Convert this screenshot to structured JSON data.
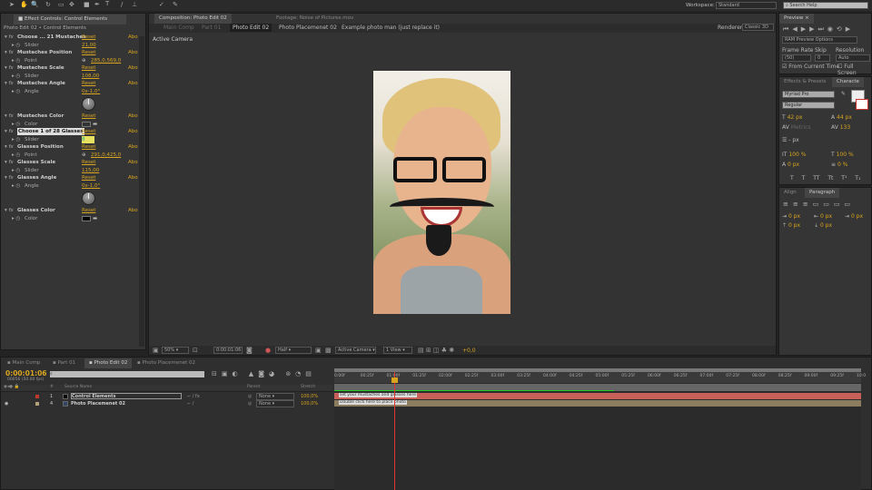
{
  "toolbar": {
    "workspace_label": "Workspace:",
    "workspace_value": "Standard",
    "search_placeholder": "Search Help"
  },
  "effect_controls": {
    "tab": "Effect Controls: Control Elements",
    "breadcrumb": "Photo Edit 02 • Control Elements",
    "reset": "Reset",
    "about": "Abo",
    "effects": [
      {
        "name": "Choose ... 21 Mustaches",
        "prop": "Slider",
        "value": "21,00",
        "kind": "slider"
      },
      {
        "name": "Mustaches Position",
        "prop": "Point",
        "value": "285,0,569,0",
        "kind": "point"
      },
      {
        "name": "Mustaches Scale",
        "prop": "Slider",
        "value": "108,00",
        "kind": "slider"
      },
      {
        "name": "Mustaches Angle",
        "prop": "Angle",
        "value": "0x-1,0°",
        "kind": "angle"
      },
      {
        "name": "Mustaches Color",
        "prop": "Color",
        "value": "",
        "kind": "color",
        "color": "#333333"
      },
      {
        "name": "Choose 1 of 28 Glasses",
        "prop": "Slider",
        "value": "8",
        "kind": "slider",
        "editing": true
      },
      {
        "name": "Glasses Position",
        "prop": "Point",
        "value": "291,0,425,0",
        "kind": "point"
      },
      {
        "name": "Glasses Scale",
        "prop": "Slider",
        "value": "115,00",
        "kind": "slider"
      },
      {
        "name": "Glasses Angle",
        "prop": "Angle",
        "value": "0x-1,0°",
        "kind": "angle"
      },
      {
        "name": "Glasses Color",
        "prop": "Color",
        "value": "",
        "kind": "color",
        "color": "#000000"
      }
    ]
  },
  "composition": {
    "tab": "Composition: Photo Edit 02",
    "footage_tab": "Footage: Noise of Pictures.mov",
    "breadcrumbs": [
      "Main Comp",
      "Part 01",
      "Photo Edit 02",
      "Photo Placemenet 02",
      "Example photo man (just replace it)"
    ],
    "active_camera": "Active Camera",
    "renderer_label": "Renderer:",
    "renderer_value": "Classic 3D",
    "viewer": {
      "zoom": "50%",
      "timecode": "0:00:01:06",
      "resolution": "Half",
      "camera": "Active Camera",
      "views": "1 View",
      "exposure": "+0,0"
    }
  },
  "preview": {
    "tab": "Preview",
    "ram_options": "RAM Preview Options",
    "frame_rate_label": "Frame Rate",
    "frame_rate": "(50)",
    "skip_label": "Skip",
    "skip": "0",
    "resolution_label": "Resolution",
    "resolution": "Auto",
    "from_current": "From Current Time",
    "full_screen": "Full Screen"
  },
  "character": {
    "tabs": [
      "Effects & Presets",
      "Characte"
    ],
    "font": "Myriad Pro",
    "style": "Regular",
    "size": "42 px",
    "leading": "44 px",
    "kerning": "Metrics",
    "tracking": "133",
    "stroke": "- px",
    "vscale": "100 %",
    "hscale": "100 %",
    "baseline": "0 px",
    "tsume": "0 %",
    "styles": [
      "T",
      "T",
      "TT",
      "Tt",
      "T¹",
      "T₁"
    ]
  },
  "paragraph": {
    "tabs": [
      "Align",
      "Paragraph"
    ],
    "indents": [
      "0 px",
      "0 px",
      "0 px",
      "0 px",
      "0 px"
    ]
  },
  "timeline": {
    "tabs": [
      "Main Comp",
      "Part 01",
      "Photo Edit 02",
      "Photo Placemenet 02"
    ],
    "timecode": "0:00:01:06",
    "frame_info": "00056 (50.00 fps)",
    "columns": {
      "num": "#",
      "source": "Source Name",
      "parent": "Parent",
      "stretch": "Stretch"
    },
    "layers": [
      {
        "num": "1",
        "name": "Control Elements",
        "parent": "None",
        "stretch": "100,0%",
        "label_color": "#c0392b",
        "bar_color": "#c8605a",
        "bar_text": "set your mustaches and glasses here"
      },
      {
        "num": "4",
        "name": "Photo Placemenet 02",
        "parent": "None",
        "stretch": "100,0%",
        "label_color": "#b5a07a",
        "bar_color": "#8b7d5e",
        "bar_text": "Double click here to place photo"
      }
    ],
    "ruler": [
      "0:00f",
      "00:25f",
      "01:00f",
      "01:25f",
      "02:00f",
      "02:25f",
      "03:00f",
      "03:25f",
      "04:00f",
      "04:25f",
      "05:00f",
      "05:25f",
      "06:00f",
      "06:25f",
      "07:00f",
      "07:25f",
      "08:00f",
      "08:25f",
      "09:00f",
      "09:25f",
      "10:0"
    ]
  }
}
